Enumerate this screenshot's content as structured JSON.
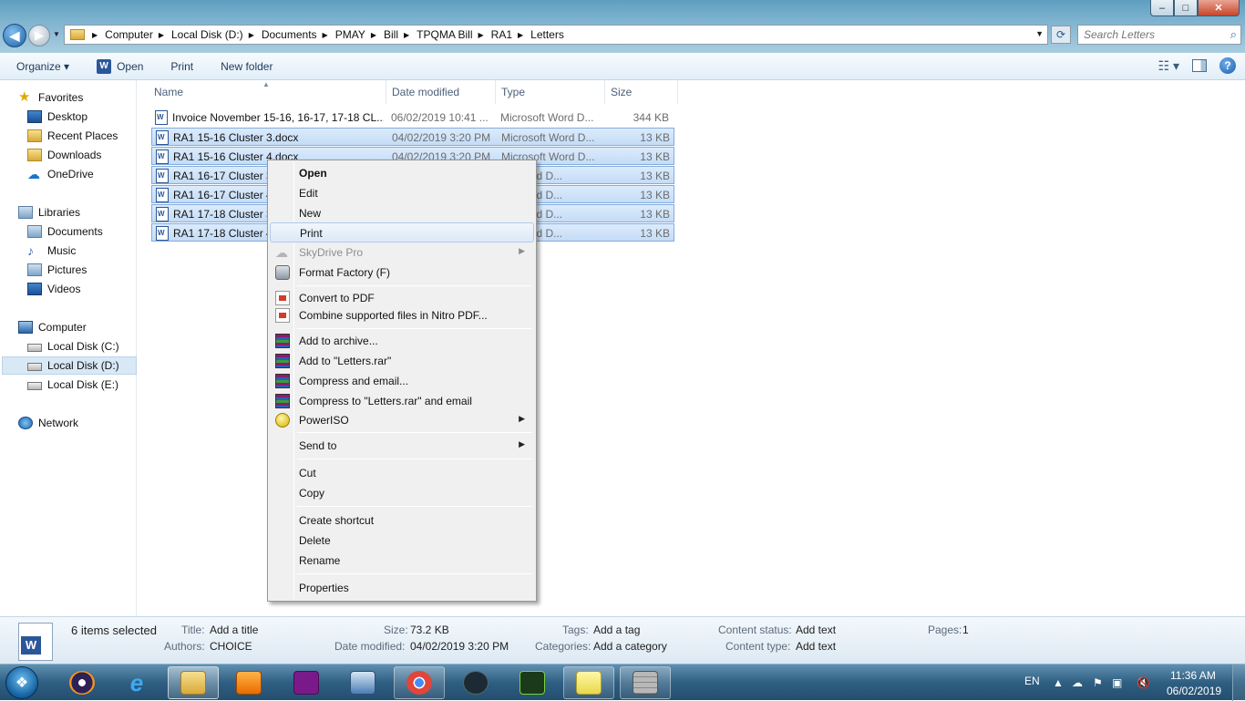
{
  "window": {
    "controls": {
      "minimize": "–",
      "maximize": "□",
      "close": "✕"
    }
  },
  "address": {
    "breadcrumbs": [
      "Computer",
      "Local Disk (D:)",
      "Documents",
      "PMAY",
      "Bill",
      "TPQMA Bill",
      "RA1",
      "Letters"
    ],
    "search_placeholder": "Search Letters"
  },
  "toolbar": {
    "organize": "Organize ▾",
    "open": "Open",
    "print": "Print",
    "new_folder": "New folder"
  },
  "nav": {
    "favorites": "Favorites",
    "desktop": "Desktop",
    "recent_places": "Recent Places",
    "downloads": "Downloads",
    "onedrive": "OneDrive",
    "libraries": "Libraries",
    "documents": "Documents",
    "music": "Music",
    "pictures": "Pictures",
    "videos": "Videos",
    "computer": "Computer",
    "disk_c": "Local Disk (C:)",
    "disk_d": "Local Disk (D:)",
    "disk_e": "Local Disk (E:)",
    "network": "Network"
  },
  "columns": {
    "name": "Name",
    "date": "Date modified",
    "type": "Type",
    "size": "Size"
  },
  "files": [
    {
      "name": "Invoice November 15-16, 16-17, 17-18 CL...",
      "date": "06/02/2019 10:41 ...",
      "type": "Microsoft Word D...",
      "size": "344 KB",
      "selected": false
    },
    {
      "name": "RA1 15-16 Cluster 3.docx",
      "date": "04/02/2019 3:20 PM",
      "type": "Microsoft Word D...",
      "size": "13 KB",
      "selected": true
    },
    {
      "name": "RA1 15-16 Cluster 4.docx",
      "date": "04/02/2019 3:20 PM",
      "type": "Microsoft Word D...",
      "size": "13 KB",
      "selected": true
    },
    {
      "name": "RA1 16-17 Cluster 3",
      "date": "",
      "type": "oft Word D...",
      "size": "13 KB",
      "selected": true
    },
    {
      "name": "RA1 16-17 Cluster 4",
      "date": "",
      "type": "oft Word D...",
      "size": "13 KB",
      "selected": true
    },
    {
      "name": "RA1 17-18 Cluster 3",
      "date": "",
      "type": "oft Word D...",
      "size": "13 KB",
      "selected": true
    },
    {
      "name": "RA1 17-18 Cluster 4",
      "date": "",
      "type": "oft Word D...",
      "size": "13 KB",
      "selected": true
    }
  ],
  "context_menu": {
    "open": "Open",
    "edit": "Edit",
    "new": "New",
    "print": "Print",
    "skydrive": "SkyDrive Pro",
    "format_factory": "Format Factory (F)",
    "convert_pdf": "Convert to PDF",
    "combine_nitro": "Combine supported files in Nitro PDF...",
    "add_archive": "Add to archive...",
    "add_rar": "Add to \"Letters.rar\"",
    "compress_email": "Compress and email...",
    "compress_rar_email": "Compress to \"Letters.rar\" and email",
    "poweriso": "PowerISO",
    "send_to": "Send to",
    "cut": "Cut",
    "copy": "Copy",
    "create_shortcut": "Create shortcut",
    "delete": "Delete",
    "rename": "Rename",
    "properties": "Properties"
  },
  "details": {
    "selected_count": "6 items selected",
    "title_k": "Title:",
    "title_v": "Add a title",
    "authors_k": "Authors:",
    "authors_v": "CHOICE",
    "size_k": "Size:",
    "size_v": "73.2 KB",
    "datemod_k": "Date modified:",
    "datemod_v": "04/02/2019 3:20 PM",
    "tags_k": "Tags:",
    "tags_v": "Add a tag",
    "categories_k": "Categories:",
    "categories_v": "Add a category",
    "cstatus_k": "Content status:",
    "cstatus_v": "Add text",
    "ctype_k": "Content type:",
    "ctype_v": "Add text",
    "pages_k": "Pages:",
    "pages_v": "1"
  },
  "taskbar": {
    "language": "EN",
    "time": "11:36 AM",
    "date": "06/02/2019",
    "accent": "#2f5f82"
  }
}
